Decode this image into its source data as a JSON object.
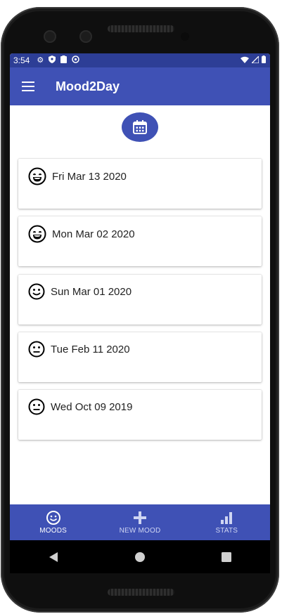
{
  "status_bar": {
    "time": "3:54",
    "left_icons": [
      "gear-icon",
      "shield-icon",
      "clipboard-icon",
      "at-icon"
    ],
    "right_icons": [
      "wifi-icon",
      "signal-icon",
      "battery-icon"
    ]
  },
  "app_bar": {
    "title": "Mood2Day",
    "menu_icon": "hamburger-icon",
    "color": "#3f51b5"
  },
  "calendar_button": {
    "icon": "calendar-icon"
  },
  "moods": [
    {
      "date": "Fri Mar 13 2020",
      "mood": "very-happy"
    },
    {
      "date": "Mon Mar 02 2020",
      "mood": "very-happy"
    },
    {
      "date": "Sun Mar 01 2020",
      "mood": "happy"
    },
    {
      "date": "Tue Feb 11 2020",
      "mood": "neutral"
    },
    {
      "date": "Wed Oct 09 2019",
      "mood": "neutral"
    }
  ],
  "bottom_nav": [
    {
      "label": "MOODS",
      "icon": "smiley-icon",
      "active": true
    },
    {
      "label": "NEW MOOD",
      "icon": "plus-icon",
      "active": false
    },
    {
      "label": "STATS",
      "icon": "bar-chart-icon",
      "active": false
    }
  ],
  "system_nav": [
    "back-icon",
    "home-icon",
    "recents-icon"
  ]
}
